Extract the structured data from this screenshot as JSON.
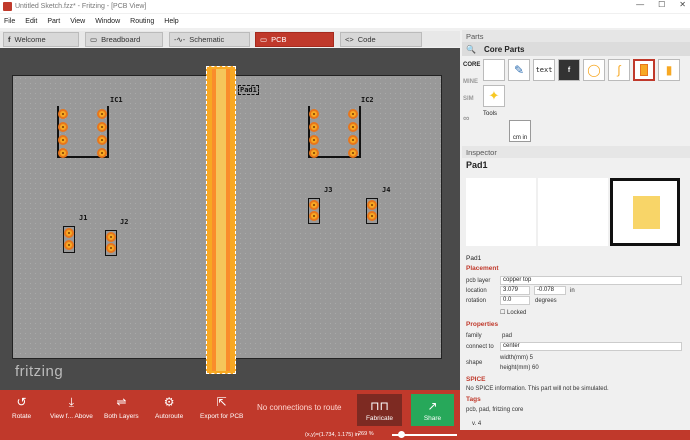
{
  "window": {
    "title": "Untitled Sketch.fzz* - Fritzing - [PCB View]",
    "min": "—",
    "max": "☐",
    "close": "✕"
  },
  "menu": [
    "File",
    "Edit",
    "Part",
    "View",
    "Window",
    "Routing",
    "Help"
  ],
  "tabs": [
    {
      "label": "Welcome",
      "icon": "f"
    },
    {
      "label": "Breadboard",
      "icon": "▭"
    },
    {
      "label": "Schematic",
      "icon": "-∿-"
    },
    {
      "label": "PCB",
      "icon": "▭"
    },
    {
      "label": "Code",
      "icon": "<>"
    }
  ],
  "canvas": {
    "labels": {
      "ic1": "IC1",
      "ic2": "IC2",
      "j1": "J1",
      "j2": "J2",
      "j3": "J3",
      "j4": "J4",
      "pad": "Pad1"
    },
    "watermark": "fritzing"
  },
  "toolbar": {
    "rotate": "Rotate",
    "view_above": "View f... Above",
    "both_layers": "Both Layers",
    "autoroute": "Autoroute",
    "export": "Export for PCB",
    "status": "No connections to route",
    "fabricate": "Fabricate",
    "share": "Share"
  },
  "statusbar": {
    "coords": "(x,y)=(1.734, 1.175) in",
    "zoom": "269 %"
  },
  "parts": {
    "header": "Parts",
    "bin_title": "Core Parts",
    "bins": [
      "CORE",
      "MINE",
      "SIM"
    ],
    "tools_label": "Tools",
    "ruler_label": "cm in",
    "text_item": "text"
  },
  "inspector": {
    "header": "Inspector",
    "title": "Pad1",
    "name": "Pad1",
    "placement_label": "Placement",
    "pcb_layer_label": "pcb layer",
    "pcb_layer": "copper top",
    "location_label": "location",
    "loc_x": "3.079",
    "loc_y": "-0.078",
    "loc_unit": "in",
    "rotation_label": "rotation",
    "rotation": "0.0",
    "rotation_unit": "degrees",
    "locked_label": "Locked",
    "properties_label": "Properties",
    "family_label": "family",
    "family": "pad",
    "connect_label": "connect to",
    "connect": "center",
    "shape_label": "shape",
    "width": "width(mm) 5",
    "height": "height(mm) 60",
    "spice_label": "SPICE",
    "spice_text": "No SPICE information. This part will not be simulated.",
    "tags_label": "Tags",
    "tags": "pcb, pad, fritzing core",
    "version": "v. 4"
  },
  "colors": {
    "accent": "#c0392b",
    "copper": "#f7a823",
    "share": "#27a85a"
  }
}
